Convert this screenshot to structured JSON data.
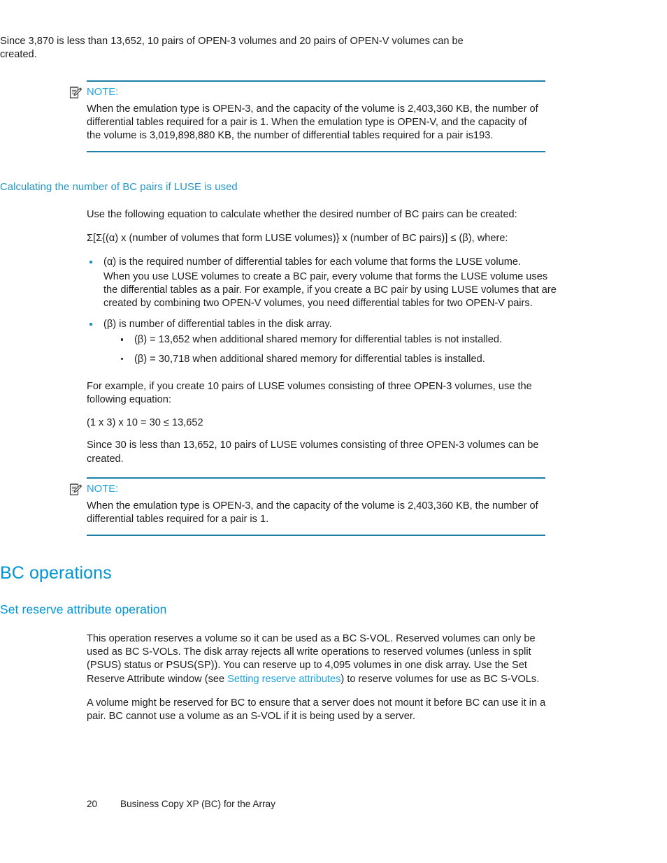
{
  "document": {
    "intro_paragraph": "Since 3,870 is less than 13,652, 10 pairs of OPEN-3 volumes and 20 pairs of OPEN-V volumes can be created.",
    "note1": {
      "label": "NOTE:",
      "icon": "note-pencil-icon",
      "text": "When the emulation type is OPEN-3, and the capacity of the volume is 2,403,360 KB, the number of differential tables required for a pair is 1. When the emulation type is OPEN-V, and the capacity of the volume is 3,019,898,880 KB, the number of differential tables required for a pair is193."
    },
    "section_luse": {
      "heading": "Calculating the number of BC pairs if LUSE is used",
      "lead": "Use the following equation to calculate whether the desired number of BC pairs can be created:",
      "equation": "Σ[Σ{(α) x (number of volumes that form LUSE volumes)} x (number of BC pairs)]  ≤  (β), where:",
      "bullets": [
        {
          "text": "(α) is the required number of differential tables for each volume that forms the LUSE volume.",
          "continuation": "When you use LUSE volumes to create a BC pair, every volume that forms the LUSE volume uses the differential tables as a pair. For example, if you create a BC pair by using LUSE volumes that are created by combining two OPEN-V volumes, you need differential tables for two OPEN-V pairs."
        },
        {
          "text": "(β) is number of differential tables in the disk array.",
          "subbullets": [
            "(β) = 13,652 when additional shared memory for differential tables is not installed.",
            "(β) = 30,718 when additional shared memory for differential tables is installed."
          ]
        }
      ],
      "example_intro": "For example, if you create 10 pairs of LUSE volumes consisting of three OPEN-3 volumes, use the following equation:",
      "example_equation": "(1 x 3) x 10 = 30  ≤  13,652",
      "example_result": "Since 30 is less than 13,652, 10 pairs of LUSE volumes consisting of three OPEN-3 volumes can be created."
    },
    "note2": {
      "label": "NOTE:",
      "icon": "note-pencil-icon",
      "text": "When the emulation type is OPEN-3, and the capacity of the volume is 2,403,360 KB, the number of differential tables required for a pair is 1."
    },
    "section_bc_operations": {
      "heading": "BC operations",
      "subsection": {
        "heading": "Set reserve attribute operation",
        "paragraph1_before_link": "This operation reserves a volume so it can be used as a BC S-VOL. Reserved volumes can only be used as BC S-VOLs. The disk array rejects all write operations to reserved volumes (unless in split (PSUS) status or PSUS(SP)). You can reserve up to 4,095 volumes in one disk array. Use the Set Reserve Attribute window (see ",
        "paragraph1_link": "Setting reserve attributes",
        "paragraph1_after_link": ") to reserve volumes for use as BC S-VOLs.",
        "paragraph2": "A volume might be reserved for BC to ensure that a server does not mount it before BC can use it in a pair. BC cannot use a volume as an S-VOL if it is being used by a server."
      }
    },
    "footer": {
      "page_number": "20",
      "running_title": "Business Copy XP (BC) for the Array"
    },
    "colors": {
      "heading_blue": "#0096d6",
      "link_blue": "#1ca3e0",
      "rule_blue": "#1b7fa8",
      "bullet_blue": "#1589b8",
      "body_text": "#1c1c1c"
    }
  }
}
